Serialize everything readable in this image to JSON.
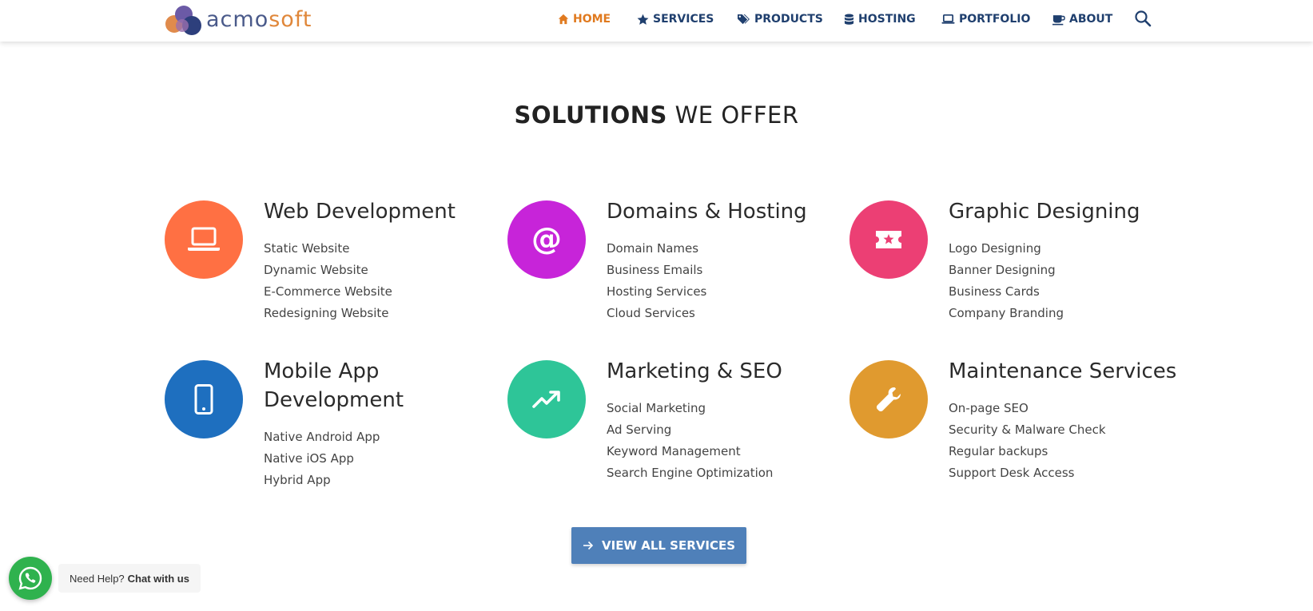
{
  "brand": {
    "logo_part1": "acmo",
    "logo_part2": "soft"
  },
  "nav": [
    {
      "label": "HOME",
      "icon": "home-icon",
      "active": true
    },
    {
      "label": "SERVICES",
      "icon": "star-icon"
    },
    {
      "label": "PRODUCTS",
      "icon": "tags-icon"
    },
    {
      "label": "HOSTING",
      "icon": "database-icon"
    },
    {
      "label": "PORTFOLIO",
      "icon": "laptop-icon"
    },
    {
      "label": "ABOUT",
      "icon": "coffee-icon"
    }
  ],
  "section": {
    "title_bold": "SOLUTIONS",
    "title_rest": "WE OFFER"
  },
  "services": [
    {
      "title": "Web Development",
      "icon": "laptop-icon",
      "color": "#ff7043",
      "items": [
        "Static Website",
        "Dynamic Website",
        "E-Commerce Website",
        "Redesigning Website"
      ]
    },
    {
      "title": "Domains & Hosting",
      "icon": "at-sign-icon",
      "color": "#c724d9",
      "items": [
        "Domain Names",
        "Business Emails",
        "Hosting Services",
        "Cloud Services"
      ]
    },
    {
      "title": "Graphic Designing",
      "icon": "ticket-star-icon",
      "color": "#ec3f74",
      "items": [
        "Logo Designing",
        "Banner Designing",
        "Business Cards",
        "Company Branding"
      ]
    },
    {
      "title": "Mobile App Development",
      "icon": "mobile-phone-icon",
      "color": "#1e6fbf",
      "items": [
        "Native Android App",
        "Native iOS App",
        "Hybrid App"
      ]
    },
    {
      "title": "Marketing & SEO",
      "icon": "trending-up-icon",
      "color": "#2ec598",
      "items": [
        "Social Marketing",
        "Ad Serving",
        "Keyword Management",
        "Search Engine Optimization"
      ]
    },
    {
      "title": "Maintenance Services",
      "icon": "wrench-icon",
      "color": "#e09a2f",
      "items": [
        "On-page SEO",
        "Security & Malware Check",
        "Regular backups",
        "Support Desk Access"
      ]
    }
  ],
  "cta": {
    "label": "VIEW ALL SERVICES"
  },
  "chat": {
    "prefix": "Need Help?",
    "bold": "Chat with us"
  }
}
